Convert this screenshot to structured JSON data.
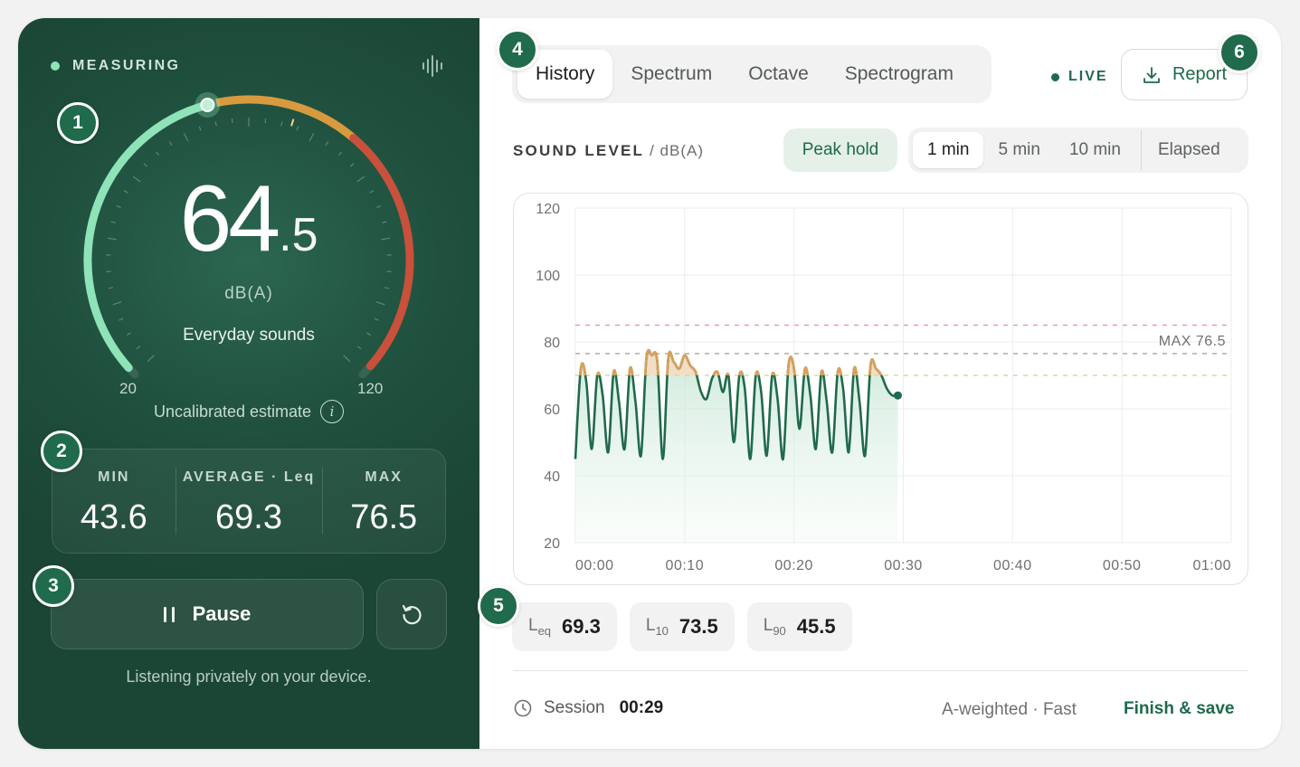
{
  "status": {
    "label": "MEASURING"
  },
  "gauge": {
    "integer": "64",
    "decimal": ".5",
    "value": 64.5,
    "unit": "dB(A)",
    "description": "Everyday sounds",
    "min_label": "20",
    "max_label": "120",
    "calibration": "Uncalibrated estimate",
    "info_glyph": "i",
    "peak_value": 76.5
  },
  "stats": {
    "min": {
      "label": "MIN",
      "value": "43.6"
    },
    "avg": {
      "label": "AVERAGE · Leq",
      "value": "69.3"
    },
    "max": {
      "label": "MAX",
      "value": "76.5"
    }
  },
  "controls": {
    "pause_label": "Pause",
    "privacy": "Listening privately on your device."
  },
  "tabs": [
    "History",
    "Spectrum",
    "Octave",
    "Spectrogram"
  ],
  "live": "LIVE",
  "report_label": "Report",
  "sound_level": {
    "title": "SOUND LEVEL",
    "unit": "/ dB(A)"
  },
  "peak_hold": "Peak hold",
  "ranges": [
    "1 min",
    "5 min",
    "10 min",
    "Elapsed"
  ],
  "chips": [
    {
      "key": "L",
      "sub": "eq",
      "value": "69.3"
    },
    {
      "key": "L",
      "sub": "10",
      "value": "73.5"
    },
    {
      "key": "L",
      "sub": "90",
      "value": "45.5"
    }
  ],
  "footer": {
    "session_label": "Session",
    "session_time": "00:29",
    "meta": "A-weighted · Fast",
    "finish": "Finish & save"
  },
  "badges": [
    "1",
    "2",
    "3",
    "4",
    "5",
    "6"
  ],
  "colors": {
    "accent": "#1e6a4b",
    "line": "#1f6b4c",
    "peak": "#d9a05a",
    "arc_green": "#8fe3b8",
    "arc_orange": "#d89a3e",
    "arc_red": "#c9503a"
  },
  "chart_data": {
    "type": "line",
    "ylim": [
      20,
      120
    ],
    "xlim": [
      0,
      60
    ],
    "y_ticks": [
      "120",
      "100",
      "80",
      "60",
      "40",
      "20"
    ],
    "x_ticks": [
      "00:00",
      "00:10",
      "00:20",
      "00:30",
      "00:40",
      "00:50",
      "01:00"
    ],
    "ref_lines": [
      {
        "value": 85,
        "color": "#e8a0a0"
      },
      {
        "value": 76.5,
        "color": "#b9b0b0",
        "label": "MAX 76.5"
      },
      {
        "value": 70,
        "color": "#dcd9a0"
      }
    ],
    "series": [
      {
        "x": [
          0,
          0.5,
          1,
          1.5,
          2,
          2.5,
          3,
          3.5,
          4,
          4.5,
          5,
          5.5,
          6,
          6.5,
          7,
          7.5,
          8,
          8.5,
          9,
          9.5,
          10,
          10.5,
          11,
          11.5,
          12,
          12.5,
          13,
          13.5,
          14,
          14.5,
          15,
          15.5,
          16,
          16.5,
          17,
          17.5,
          18,
          18.5,
          19,
          19.5,
          20,
          20.5,
          21,
          21.5,
          22,
          22.5,
          23,
          23.5,
          24,
          24.5,
          25,
          25.5,
          26,
          26.5,
          27,
          27.5,
          28,
          28.5,
          29,
          29.5
        ],
        "y": [
          45,
          72,
          68,
          48,
          70,
          64,
          47,
          71,
          62,
          48,
          72,
          62,
          46,
          75,
          76,
          74,
          45,
          75,
          74,
          72,
          76,
          73,
          71,
          65,
          63,
          69,
          71,
          65,
          70,
          50,
          70,
          66,
          45,
          70,
          65,
          46,
          70,
          63,
          45,
          73,
          72,
          54,
          72,
          64,
          48,
          71,
          62,
          47,
          71,
          66,
          47,
          72,
          62,
          46,
          73,
          72,
          70,
          66,
          64,
          64
        ]
      }
    ]
  }
}
